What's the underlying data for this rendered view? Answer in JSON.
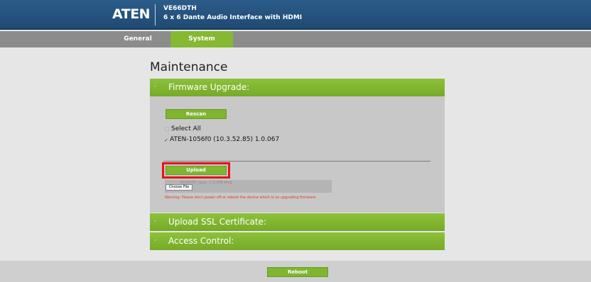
{
  "header": {
    "logo": "ATEN",
    "model": "VE66DTH",
    "description": "6 x 6 Dante Audio Interface with HDMI"
  },
  "tabs": [
    {
      "label": "General"
    },
    {
      "label": "System",
      "active": true
    }
  ],
  "page_title": "Maintenance",
  "sections": {
    "firmware": {
      "bullet": "·",
      "label": "Firmware Upgrade:"
    },
    "ssl": {
      "bullet": "·",
      "label": "Upload SSL Certificate:"
    },
    "access": {
      "bullet": "·",
      "label": "Access Control:"
    }
  },
  "firmware": {
    "rescan_label": "Rescan",
    "select_all_mark": "□",
    "select_all_label": "Select All",
    "device_mark": "✓",
    "device_label": "ATEN-1056f0 (10.3.52.85) 1.0.067",
    "upload_label": "Upload",
    "file_name": "VE66DTH_upgr...1.0.068.bmg",
    "choose_file_label": "Choose File",
    "warning": "Warning: Please don't power off or reboot the device which is on upgrading firmware."
  },
  "footer": {
    "reboot_label": "Reboot"
  },
  "colors": {
    "header": "#2c5c8a",
    "accent_green": "#80b530",
    "tab_bar": "#8c8c8c",
    "highlight": "#e8121b",
    "warning": "#e0392b"
  }
}
